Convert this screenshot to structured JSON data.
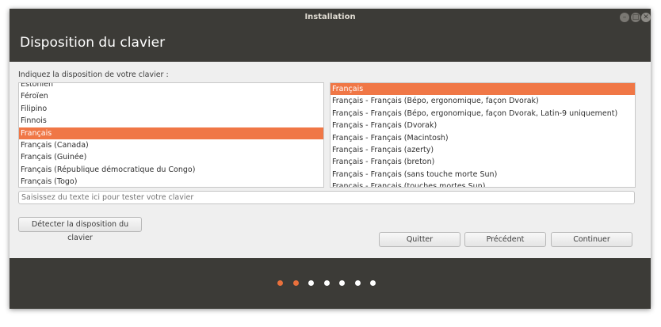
{
  "window": {
    "title": "Installation"
  },
  "header": {
    "title": "Disposition du clavier"
  },
  "prompt": "Indiquez la disposition de votre clavier :",
  "layouts": {
    "items": [
      {
        "label": "Estonien",
        "selected": false
      },
      {
        "label": "Féroïen",
        "selected": false
      },
      {
        "label": "Filipino",
        "selected": false
      },
      {
        "label": "Finnois",
        "selected": false
      },
      {
        "label": "Français",
        "selected": true
      },
      {
        "label": "Français (Canada)",
        "selected": false
      },
      {
        "label": "Français (Guinée)",
        "selected": false
      },
      {
        "label": "Français (République démocratique du Congo)",
        "selected": false
      },
      {
        "label": "Français (Togo)",
        "selected": false
      }
    ]
  },
  "variants": {
    "items": [
      {
        "label": "Français",
        "selected": true
      },
      {
        "label": "Français - Français (Bépo, ergonomique, façon Dvorak)",
        "selected": false
      },
      {
        "label": "Français - Français (Bépo, ergonomique, façon Dvorak, Latin-9 uniquement)",
        "selected": false
      },
      {
        "label": "Français - Français (Dvorak)",
        "selected": false
      },
      {
        "label": "Français - Français (Macintosh)",
        "selected": false
      },
      {
        "label": "Français - Français (azerty)",
        "selected": false
      },
      {
        "label": "Français - Français (breton)",
        "selected": false
      },
      {
        "label": "Français - Français (sans touche morte Sun)",
        "selected": false
      },
      {
        "label": "Français - Français (touches mortes Sun)",
        "selected": false
      }
    ]
  },
  "test_input": {
    "placeholder": "Saisissez du texte ici pour tester votre clavier",
    "value": ""
  },
  "buttons": {
    "detect": "Détecter la disposition du clavier",
    "quit": "Quitter",
    "previous": "Précédent",
    "continue": "Continuer"
  },
  "progress": {
    "total_steps": 7,
    "current_step": 2
  },
  "colors": {
    "accent": "#f07746",
    "dark": "#3c3b37",
    "background": "#efefef"
  }
}
